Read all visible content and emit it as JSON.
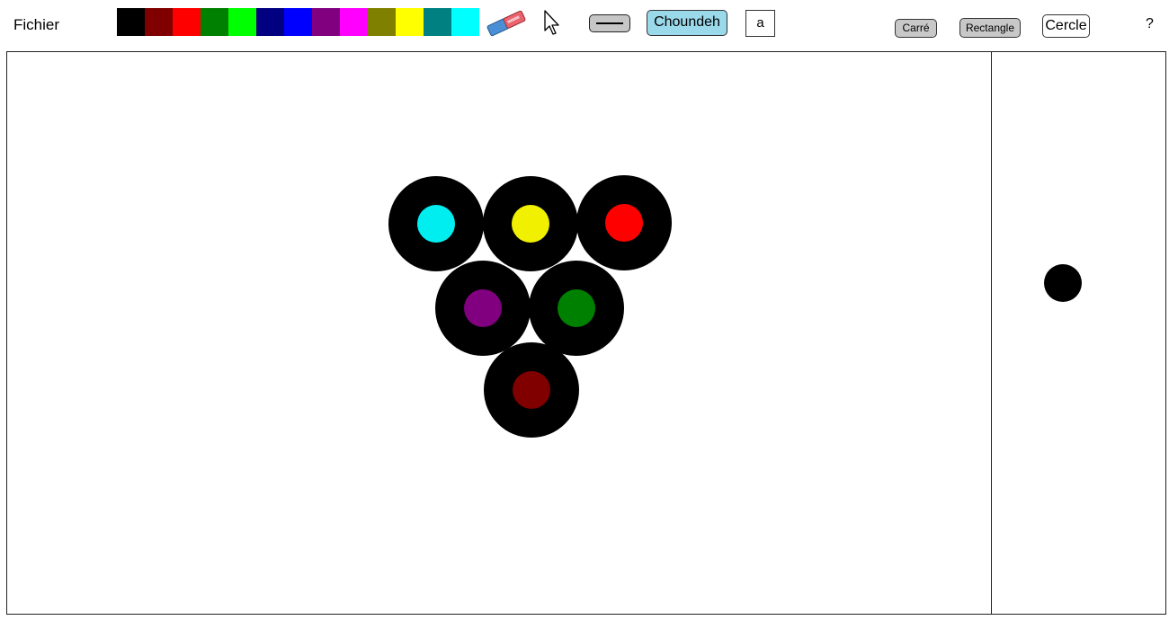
{
  "menu": {
    "fichier": "Fichier"
  },
  "palette": [
    {
      "name": "black",
      "color": "#000000",
      "selected": true
    },
    {
      "name": "maroon",
      "color": "#800000",
      "selected": false
    },
    {
      "name": "red",
      "color": "#ff0000",
      "selected": false
    },
    {
      "name": "green",
      "color": "#008000",
      "selected": false
    },
    {
      "name": "lime",
      "color": "#00ff00",
      "selected": false
    },
    {
      "name": "navy",
      "color": "#000080",
      "selected": false
    },
    {
      "name": "blue",
      "color": "#0000ff",
      "selected": false
    },
    {
      "name": "purple",
      "color": "#800080",
      "selected": false
    },
    {
      "name": "magenta",
      "color": "#ff00ff",
      "selected": false
    },
    {
      "name": "olive",
      "color": "#808000",
      "selected": false
    },
    {
      "name": "yellow",
      "color": "#ffff00",
      "selected": false
    },
    {
      "name": "teal",
      "color": "#008080",
      "selected": false
    },
    {
      "name": "cyan",
      "color": "#00ffff",
      "selected": false
    }
  ],
  "tools": {
    "eraser_icon": "eraser-icon",
    "pointer_icon": "cursor-arrow-icon",
    "line_icon": "line-thickness-icon"
  },
  "buttons": {
    "choundeh": "Choundeh",
    "letter": "a",
    "carre": "Carré",
    "rectangle": "Rectangle",
    "cercle": "Cercle",
    "help": "?"
  },
  "canvas": {
    "ring_color": "#000000",
    "shapes": [
      {
        "name": "ring-cyan",
        "center_color": "#00eef0"
      },
      {
        "name": "ring-yellow",
        "center_color": "#f0f000"
      },
      {
        "name": "ring-red",
        "center_color": "#ff0000"
      },
      {
        "name": "ring-purple",
        "center_color": "#800080"
      },
      {
        "name": "ring-green",
        "center_color": "#008000"
      },
      {
        "name": "ring-maroon",
        "center_color": "#800000"
      }
    ]
  },
  "preview": {
    "brush_color": "#000000"
  }
}
